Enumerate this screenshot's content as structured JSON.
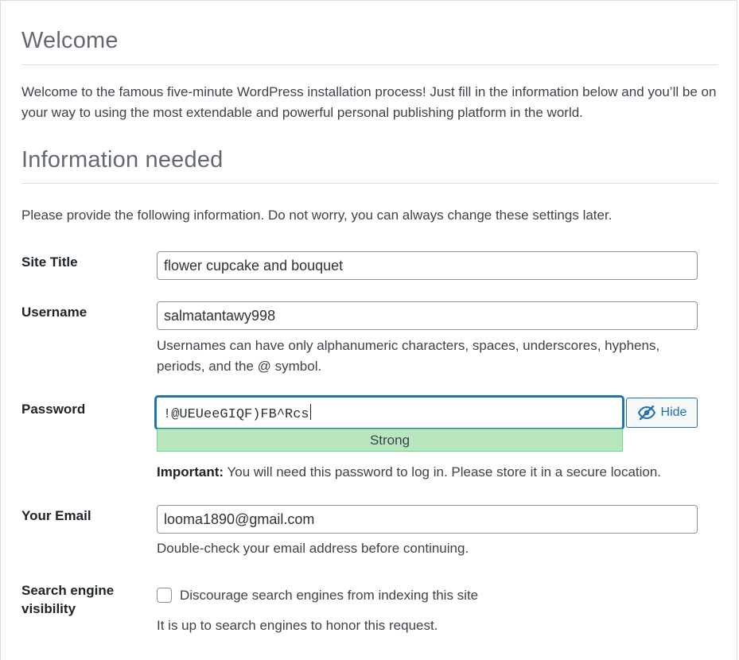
{
  "welcome": {
    "heading": "Welcome",
    "intro": "Welcome to the famous five-minute WordPress installation process! Just fill in the information below and you’ll be on your way to using the most extendable and powerful personal publishing platform in the world."
  },
  "info": {
    "heading": "Information needed",
    "note": "Please provide the following information. Do not worry, you can always change these settings later."
  },
  "form": {
    "site_title": {
      "label": "Site Title",
      "value": "flower cupcake and bouquet"
    },
    "username": {
      "label": "Username",
      "value": "salmatantawy998",
      "hint_line1": "Usernames can have only alphanumeric characters, spaces, underscores, hyphens,",
      "hint_line2": "periods, and the @ symbol."
    },
    "password": {
      "label": "Password",
      "value": "!@UEUeeGIQF)FB^Rcs",
      "strength": "Strong",
      "hide_label": "Hide",
      "important_bold": "Important:",
      "important_text": " You will need this password to log in. Please store it in a secure location."
    },
    "email": {
      "label": "Your Email",
      "value": "looma1890@gmail.com",
      "hint": "Double-check your email address before continuing."
    },
    "search_visibility": {
      "label_line1": "Search engine",
      "label_line2": "visibility",
      "checkbox_label": "Discourage search engines from indexing this site",
      "checked": false,
      "hint": "It is up to search engines to honor this request."
    }
  },
  "icons": {
    "hide": "eye-slash-icon"
  },
  "colors": {
    "accent": "#2271b1",
    "strength_bg": "#b8e6bf",
    "strength_border": "#68de7c"
  }
}
